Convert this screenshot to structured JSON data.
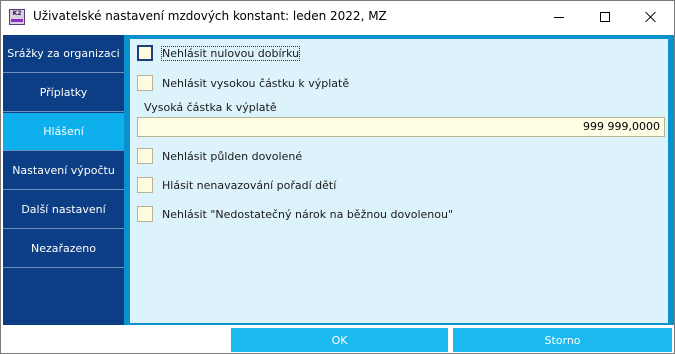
{
  "window": {
    "title": "Uživatelské nastavení mzdových konstant: leden 2022, MZ",
    "app_icon_text": "K2"
  },
  "sidebar": {
    "items": [
      {
        "label": "Srážky za organizaci",
        "active": false
      },
      {
        "label": "Příplatky",
        "active": false
      },
      {
        "label": "Hlášení",
        "active": true
      },
      {
        "label": "Nastavení výpočtu",
        "active": false
      },
      {
        "label": "Další nastavení",
        "active": false
      },
      {
        "label": "Nezařazeno",
        "active": false
      }
    ]
  },
  "form": {
    "checkboxes": [
      {
        "label": "Nehlásit nulovou dobírku",
        "checked": false,
        "focused": true
      },
      {
        "label": "Nehlásit vysokou částku k výplatě",
        "checked": false
      },
      {
        "label": "Nehlásit půlden dovolené",
        "checked": false
      },
      {
        "label": "Hlásit nenavazování pořadí dětí",
        "checked": false
      },
      {
        "label": "Nehlásit \"Nedostatečný nárok na běžnou dovolenou\"",
        "checked": false
      }
    ],
    "amount_label": "Vysoká částka k výplatě",
    "amount_value": "999 999,0000"
  },
  "buttons": {
    "ok": "OK",
    "cancel": "Storno"
  },
  "colors": {
    "sidebar_bg": "#0b3e84",
    "sidebar_active": "#0db0ec",
    "content_border": "#0a91d0",
    "content_bg": "#dcf3fb",
    "field_bg": "#fffde3",
    "button_bg": "#1ab9ef"
  }
}
